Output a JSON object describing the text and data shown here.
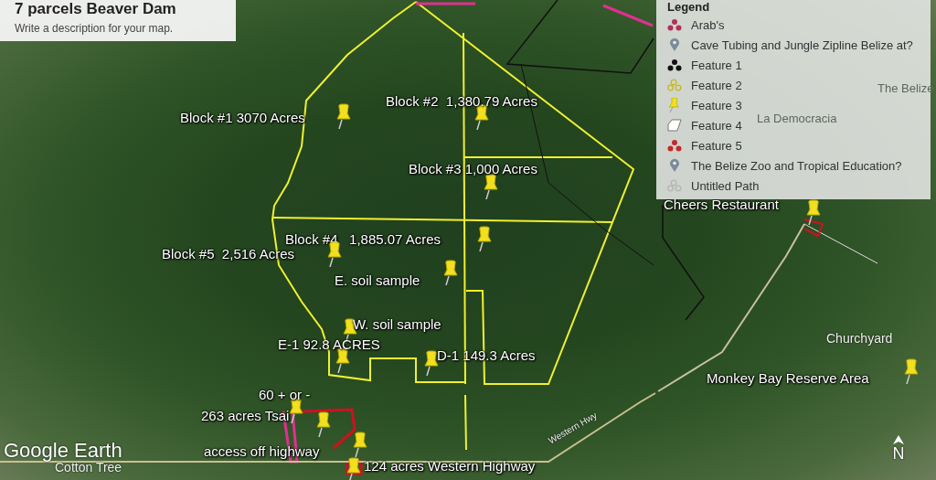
{
  "map_card": {
    "title": "7 parcels Beaver Dam",
    "description": "Write a description for your map."
  },
  "legend": {
    "title": "Legend",
    "items": [
      {
        "label": "Arab's",
        "kind": "cluster",
        "color": "#b0305a"
      },
      {
        "label": "Cave Tubing and Jungle Zipline Belize at?",
        "kind": "pin",
        "color": "#7d8b99"
      },
      {
        "label": "Feature 1",
        "kind": "cluster",
        "color": "#111111"
      },
      {
        "label": "Feature 2",
        "kind": "ring-cluster",
        "color": "#c9b81a"
      },
      {
        "label": "Feature 3",
        "kind": "pushpin",
        "color": "#f2e020"
      },
      {
        "label": "Feature 4",
        "kind": "polygon",
        "color": "#ffffff"
      },
      {
        "label": "Feature 5",
        "kind": "cluster",
        "color": "#c02a2a"
      },
      {
        "label": "The Belize Zoo and Tropical Education?",
        "kind": "pin",
        "color": "#7d8b99"
      },
      {
        "label": "Untitled Path",
        "kind": "ring-cluster",
        "color": "#b5b5b5"
      }
    ]
  },
  "placemarks": [
    {
      "label": "Block #1 3070 Acres"
    },
    {
      "label": "Block #2  1,380.79 Acres"
    },
    {
      "label": "Block #3 1,000 Acres"
    },
    {
      "label": "Block #4   1,885.07 Acres"
    },
    {
      "label": "Block #5  2,516 Acres"
    },
    {
      "label": "E. soil sample"
    },
    {
      "label": "W. soil sample"
    },
    {
      "label": "E-1 92.8 ACRES"
    },
    {
      "label": "D-1 149.3 Acres"
    },
    {
      "label": "60 + or -"
    },
    {
      "label": "263 acres Tsai"
    },
    {
      "label": "access off highway"
    },
    {
      "label": "124 acres Western Highway"
    },
    {
      "label": "Cheers Restaurant"
    },
    {
      "label": "Monkey Bay Reserve Area"
    }
  ],
  "place_labels": [
    "The Belize",
    "La Democracia",
    "Churchyard",
    "Western Hwy",
    "Cotton Tree"
  ],
  "logo": "Google Earth",
  "compass": "N"
}
